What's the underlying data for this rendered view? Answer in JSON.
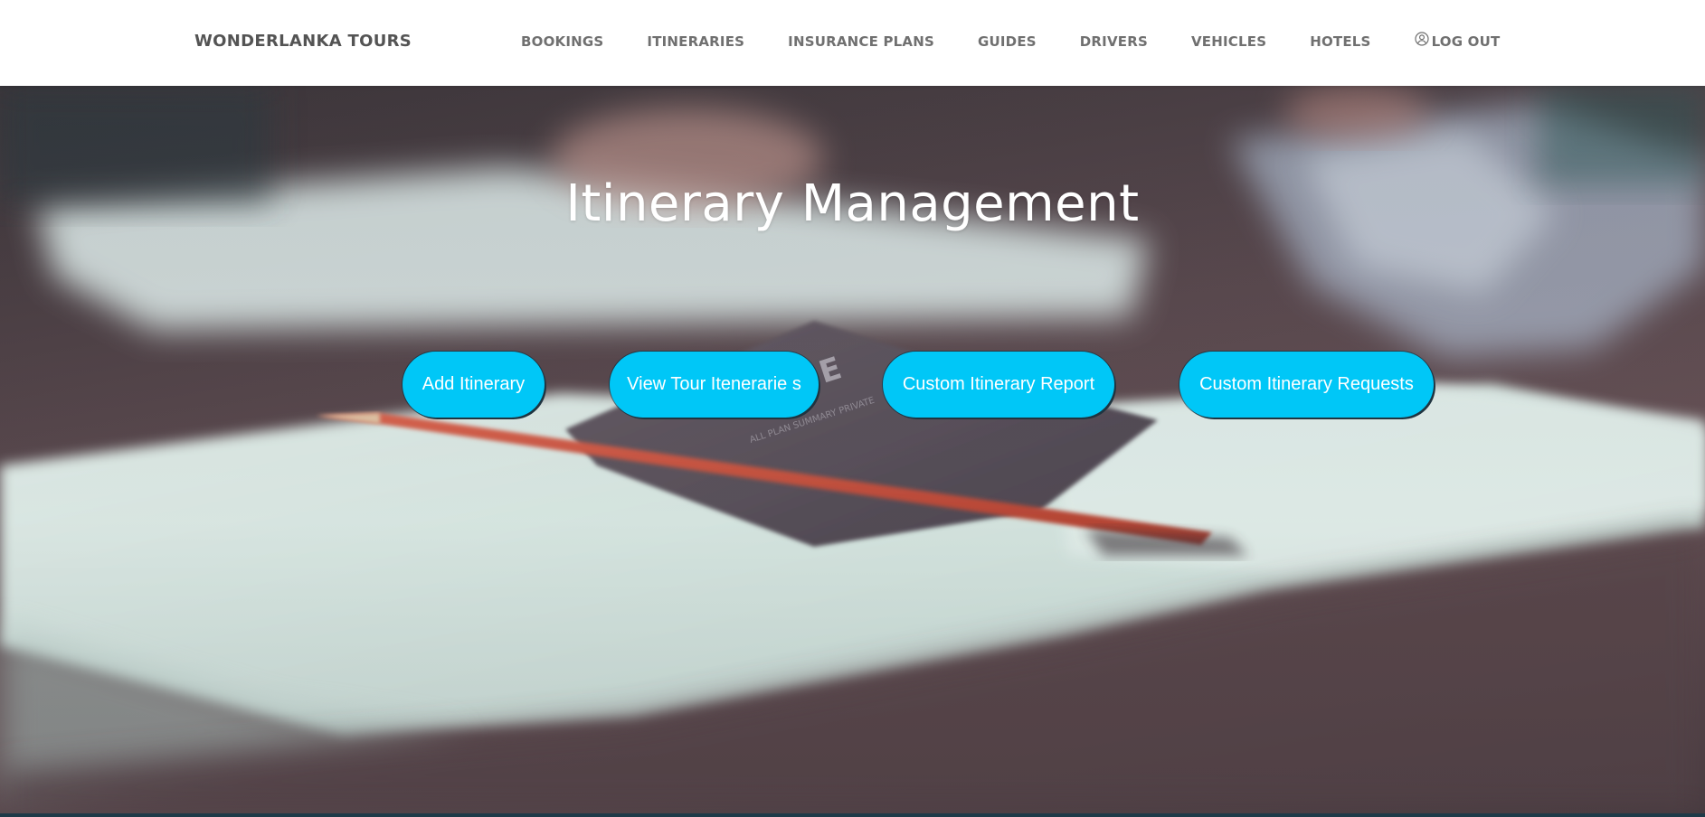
{
  "brand": "WONDERLANKA TOURS",
  "nav": {
    "items": [
      {
        "label": "BOOKINGS"
      },
      {
        "label": "ITINERARIES"
      },
      {
        "label": "INSURANCE PLANS"
      },
      {
        "label": "GUIDES"
      },
      {
        "label": "DRIVERS"
      },
      {
        "label": "VEHICLES"
      },
      {
        "label": "HOTELS"
      }
    ],
    "logout": {
      "label": "LOG OUT",
      "icon": "user-circle-icon"
    }
  },
  "hero": {
    "title": "Itinerary Management",
    "buttons": [
      {
        "label": "Add Itinerary"
      },
      {
        "label": "View Tour Itenerarie s"
      },
      {
        "label": "Custom Itinerary Report"
      },
      {
        "label": "Custom Itinerary Requests"
      }
    ]
  },
  "colors": {
    "button": "#00c7f7",
    "navbar_bg": "#ffffff",
    "nav_text": "#707070",
    "brand_text": "#545454",
    "title_text": "#ffffff"
  }
}
